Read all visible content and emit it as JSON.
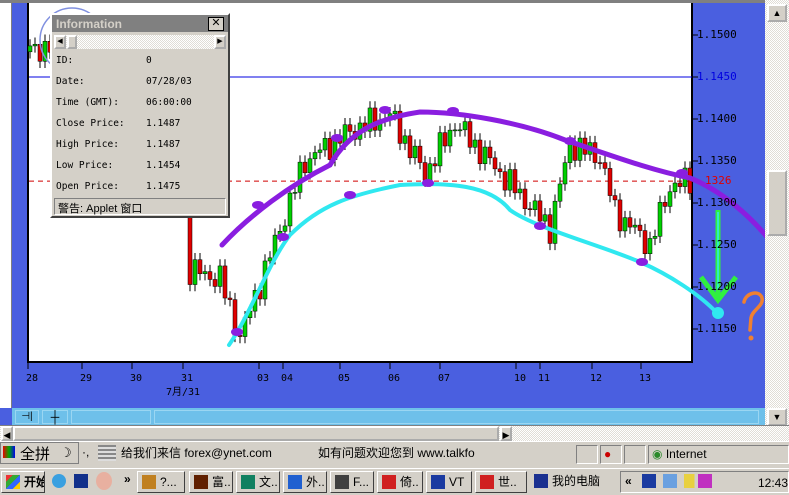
{
  "info_dialog": {
    "title": "Information",
    "close": "✕",
    "rows": [
      {
        "label": "ID:",
        "value": "0"
      },
      {
        "label": "Date:",
        "value": "07/28/03"
      },
      {
        "label": "Time (GMT):",
        "value": "06:00:00"
      },
      {
        "label": "Close Price:",
        "value": "1.1487"
      },
      {
        "label": "High Price:",
        "value": "1.1487"
      },
      {
        "label": "Low Price:",
        "value": "1.1454"
      },
      {
        "label": "Open Price:",
        "value": "1.1475"
      }
    ],
    "footer": "警告: Applet 窗口"
  },
  "chart": {
    "price_ticks": [
      "1.1500",
      "1.1450",
      "1.1400",
      "1.1350",
      "1.1300",
      "1.1250",
      "1.1200",
      "1.1150"
    ],
    "price_values": [
      1.15,
      1.145,
      1.14,
      1.135,
      1.13,
      1.125,
      1.12,
      1.115
    ],
    "blue_line_value": 1.145,
    "current_price_label": "1326",
    "current_price": 1.1326,
    "date_ticks": [
      "28",
      "29",
      "30",
      "31",
      "03",
      "04",
      "05",
      "06",
      "07",
      "10",
      "11",
      "12",
      "13"
    ],
    "month_label": "7月/31",
    "price_path": [
      [
        0,
        1.148
      ],
      [
        5,
        1.149
      ],
      [
        30,
        1.147
      ],
      [
        32,
        1.122
      ],
      [
        38,
        1.121
      ],
      [
        42,
        1.114
      ],
      [
        55,
        1.135
      ],
      [
        64,
        1.1385
      ],
      [
        72,
        1.1405
      ],
      [
        79,
        1.1335
      ],
      [
        85,
        1.1395
      ],
      [
        95,
        1.133
      ],
      [
        104,
        1.127
      ],
      [
        108,
        1.137
      ],
      [
        114,
        1.1355
      ],
      [
        117,
        1.129
      ],
      [
        124,
        1.125
      ],
      [
        128,
        1.132
      ],
      [
        132,
        1.1326
      ]
    ],
    "colors": {
      "up": "#00d000",
      "down": "#e00000",
      "purple": "#8a1ee0",
      "cyan": "#30e8f0",
      "green": "#30f040",
      "orange": "#f08030"
    }
  },
  "toolbar": {
    "pin": "⊣|",
    "crosshair": "┼"
  },
  "statusbar": {
    "ime": "全拼",
    "moon": "☽",
    "dots": "·,",
    "mail": "给我们来信  forex@ynet.com",
    "welcome": "如有问题欢迎您到  www.talkfo",
    "zone": "Internet"
  },
  "taskbar": {
    "start": "开始",
    "items": [
      "?...",
      "富..",
      "文..",
      "外..",
      "F...",
      "倚..",
      "VT",
      "世..",
      "我的电脑"
    ],
    "clock": "12:43",
    "chevron": "»"
  }
}
